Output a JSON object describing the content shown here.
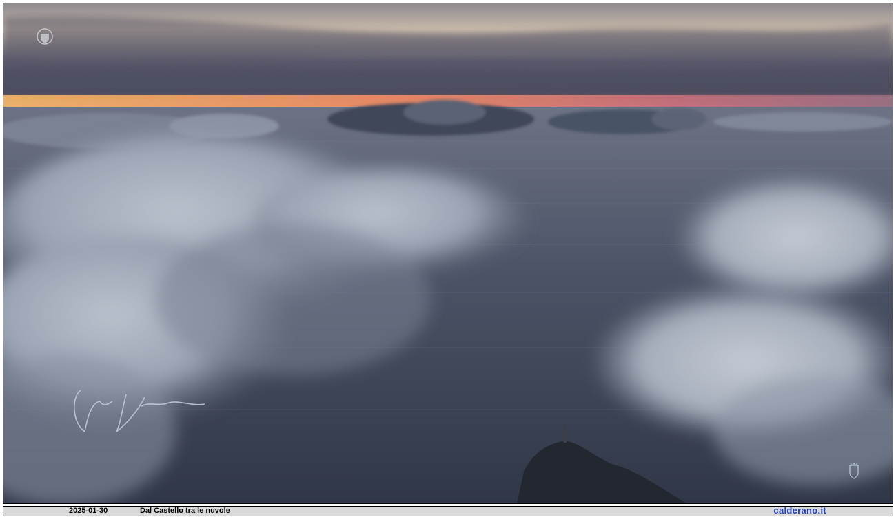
{
  "caption": {
    "date": "2025-01-30",
    "title": "Dal Castello tra le nuvole",
    "site": "calderano.it"
  },
  "scene": {
    "description_icons": [
      "crest-logo-icon",
      "signature-mark",
      "coat-of-arms-icon"
    ],
    "colors": {
      "sky_top": "#7f7a83",
      "sunset_band": "#f2a866",
      "sea": "#4a5264",
      "cloud": "#c9d0da",
      "site_text": "#1f3fae"
    }
  }
}
